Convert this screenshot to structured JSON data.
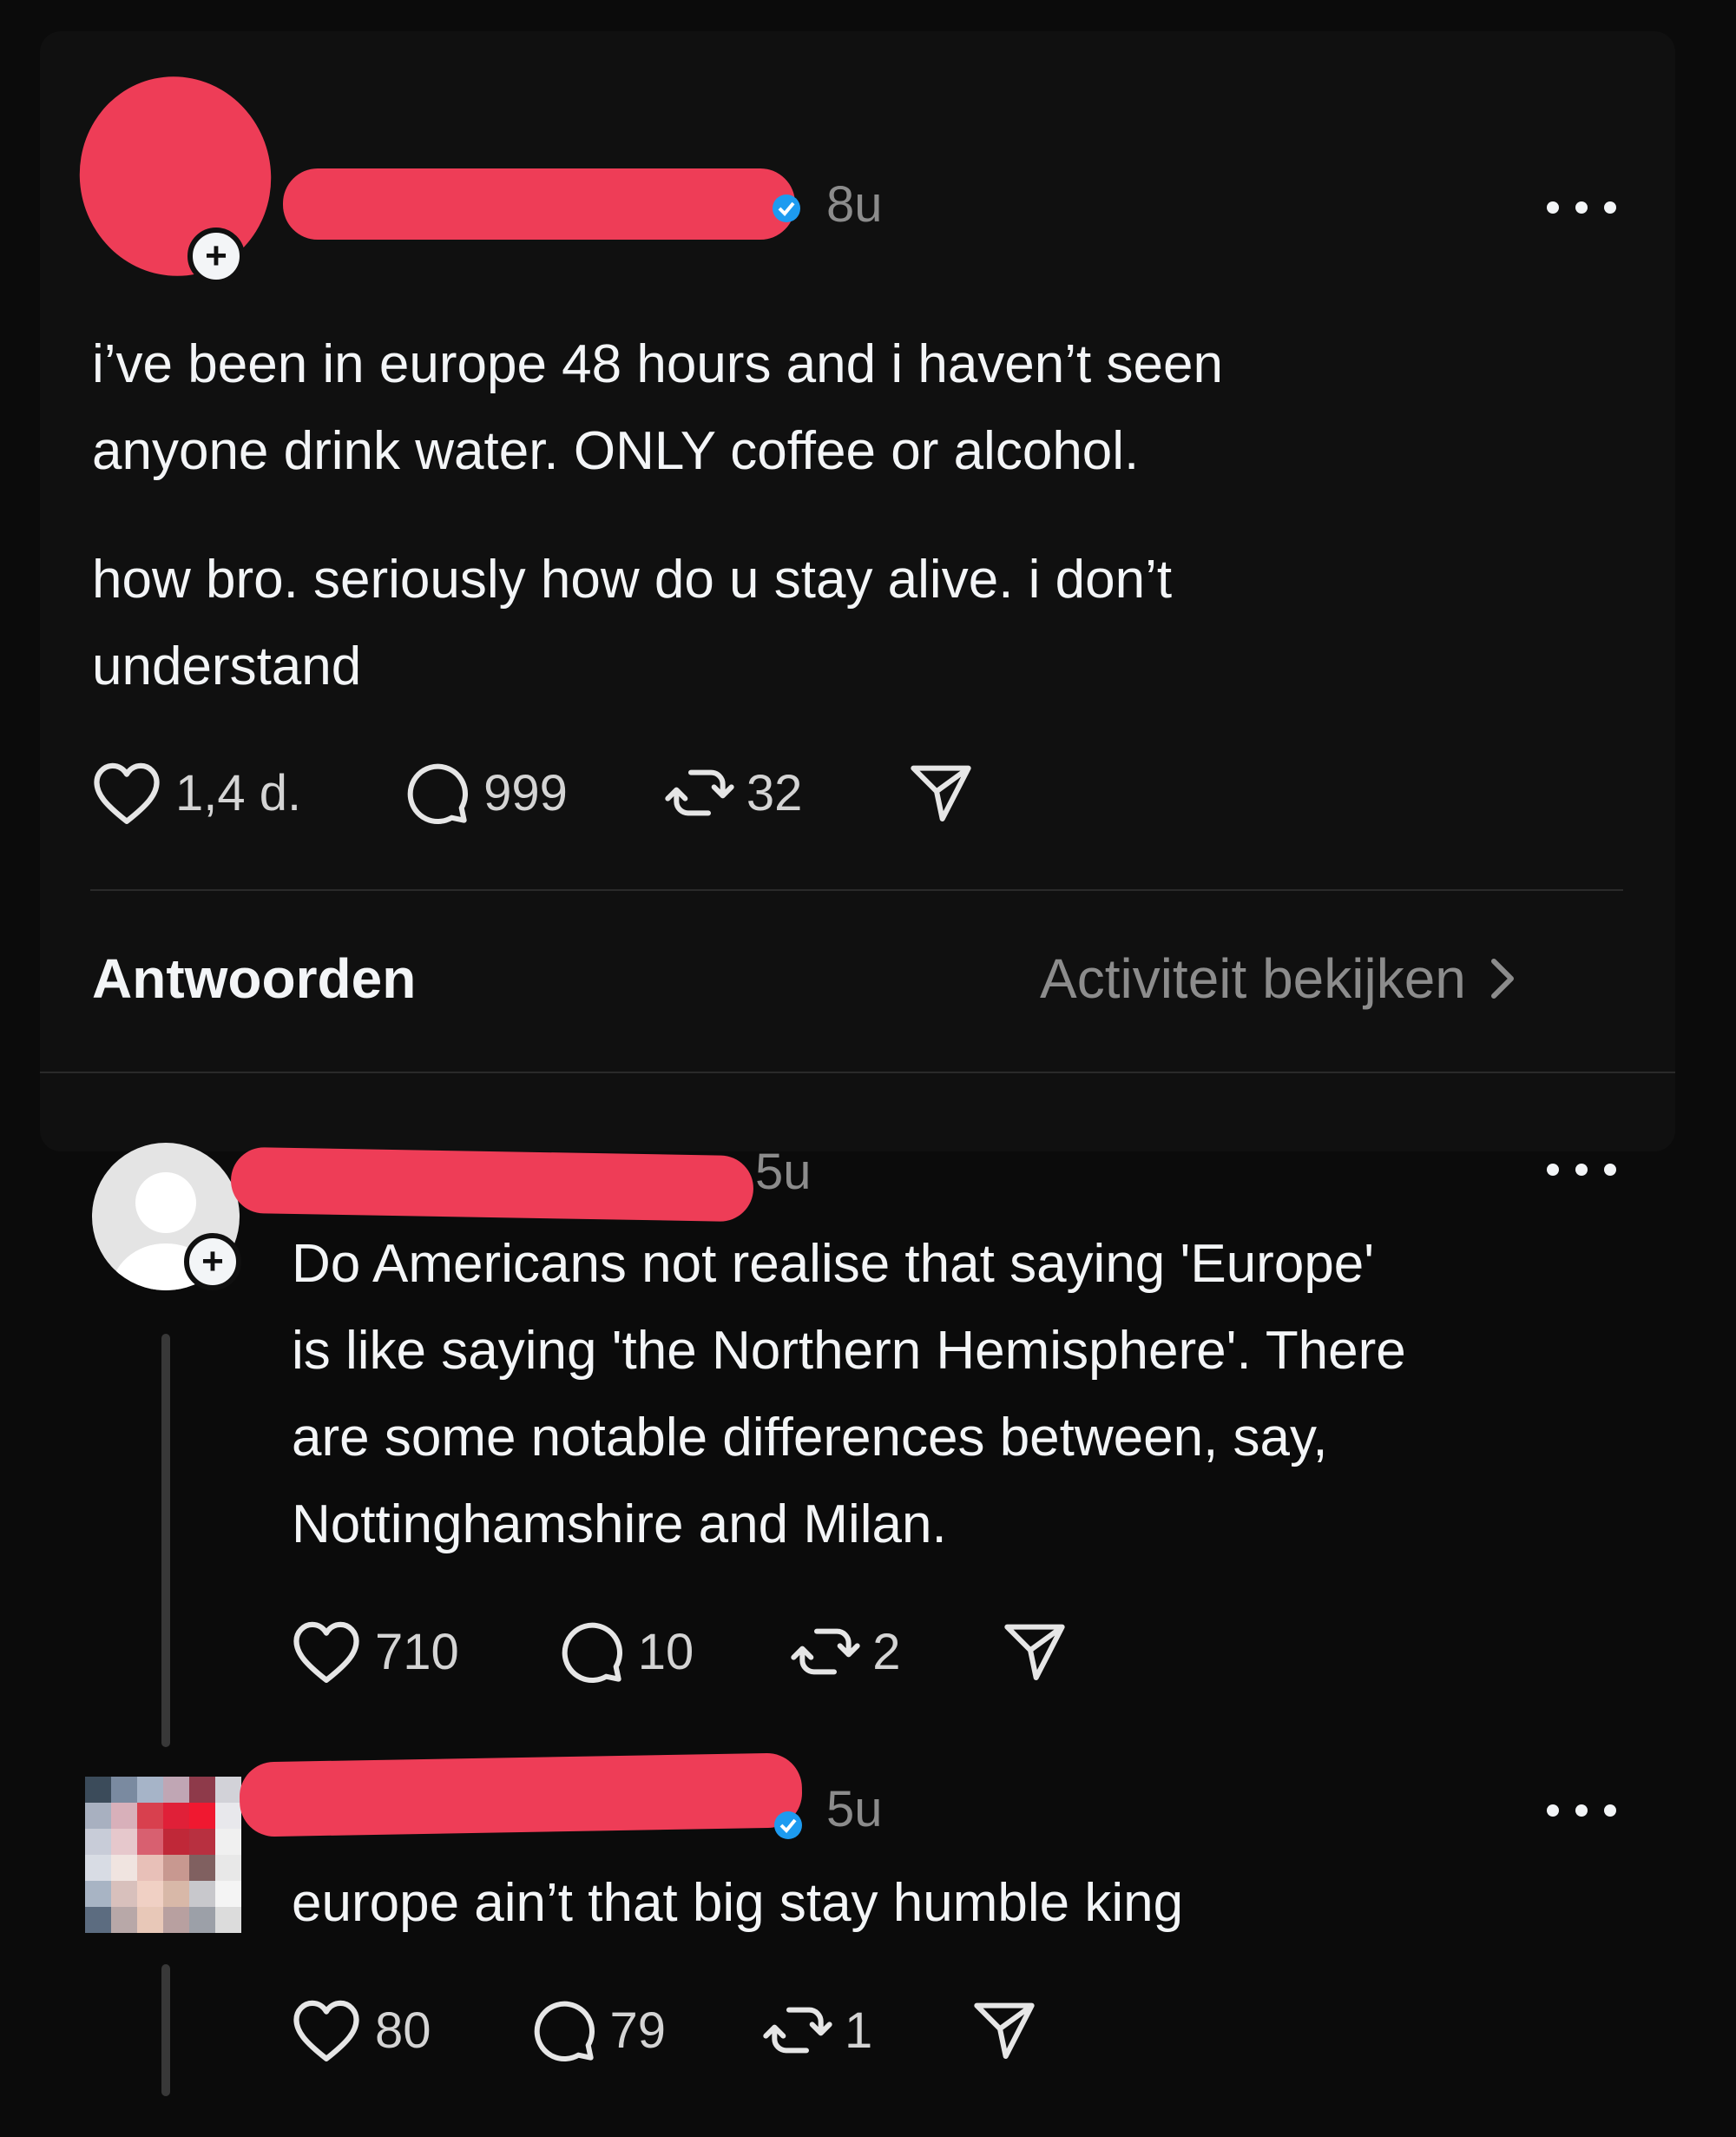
{
  "post": {
    "time": "8u",
    "text_line1": "i’ve been in europe 48 hours and i haven’t seen",
    "text_line2": "anyone drink water. ONLY coffee or alcohol.",
    "text_line3": "how bro. seriously how do u stay alive. i don’t",
    "text_line4": "understand",
    "likes": "1,4 d.",
    "comments": "999",
    "reposts": "32"
  },
  "tabs": {
    "replies_label": "Antwoorden",
    "activity_label": "Activiteit bekijken"
  },
  "reply1": {
    "time": "5u",
    "text_line1": "Do Americans not realise that saying 'Europe'",
    "text_line2": "is like saying 'the Northern Hemisphere'. There",
    "text_line3": "are some notable differences between, say,",
    "text_line4": "Nottinghamshire and Milan.",
    "likes": "710",
    "comments": "10",
    "reposts": "2"
  },
  "reply2": {
    "time": "5u",
    "text": "europe ain’t that big stay humble king",
    "likes": "80",
    "comments": "79",
    "reposts": "1"
  },
  "colors": {
    "redaction": "#ee3d57",
    "verified": "#1d9bf0",
    "background": "#0b0b0b",
    "text": "#f3f5f7",
    "muted": "#8c8c8c"
  },
  "icons": [
    "heart-icon",
    "comment-icon",
    "repost-icon",
    "share-icon",
    "more-icon",
    "verified-icon",
    "plus-icon",
    "chevron-right-icon"
  ]
}
